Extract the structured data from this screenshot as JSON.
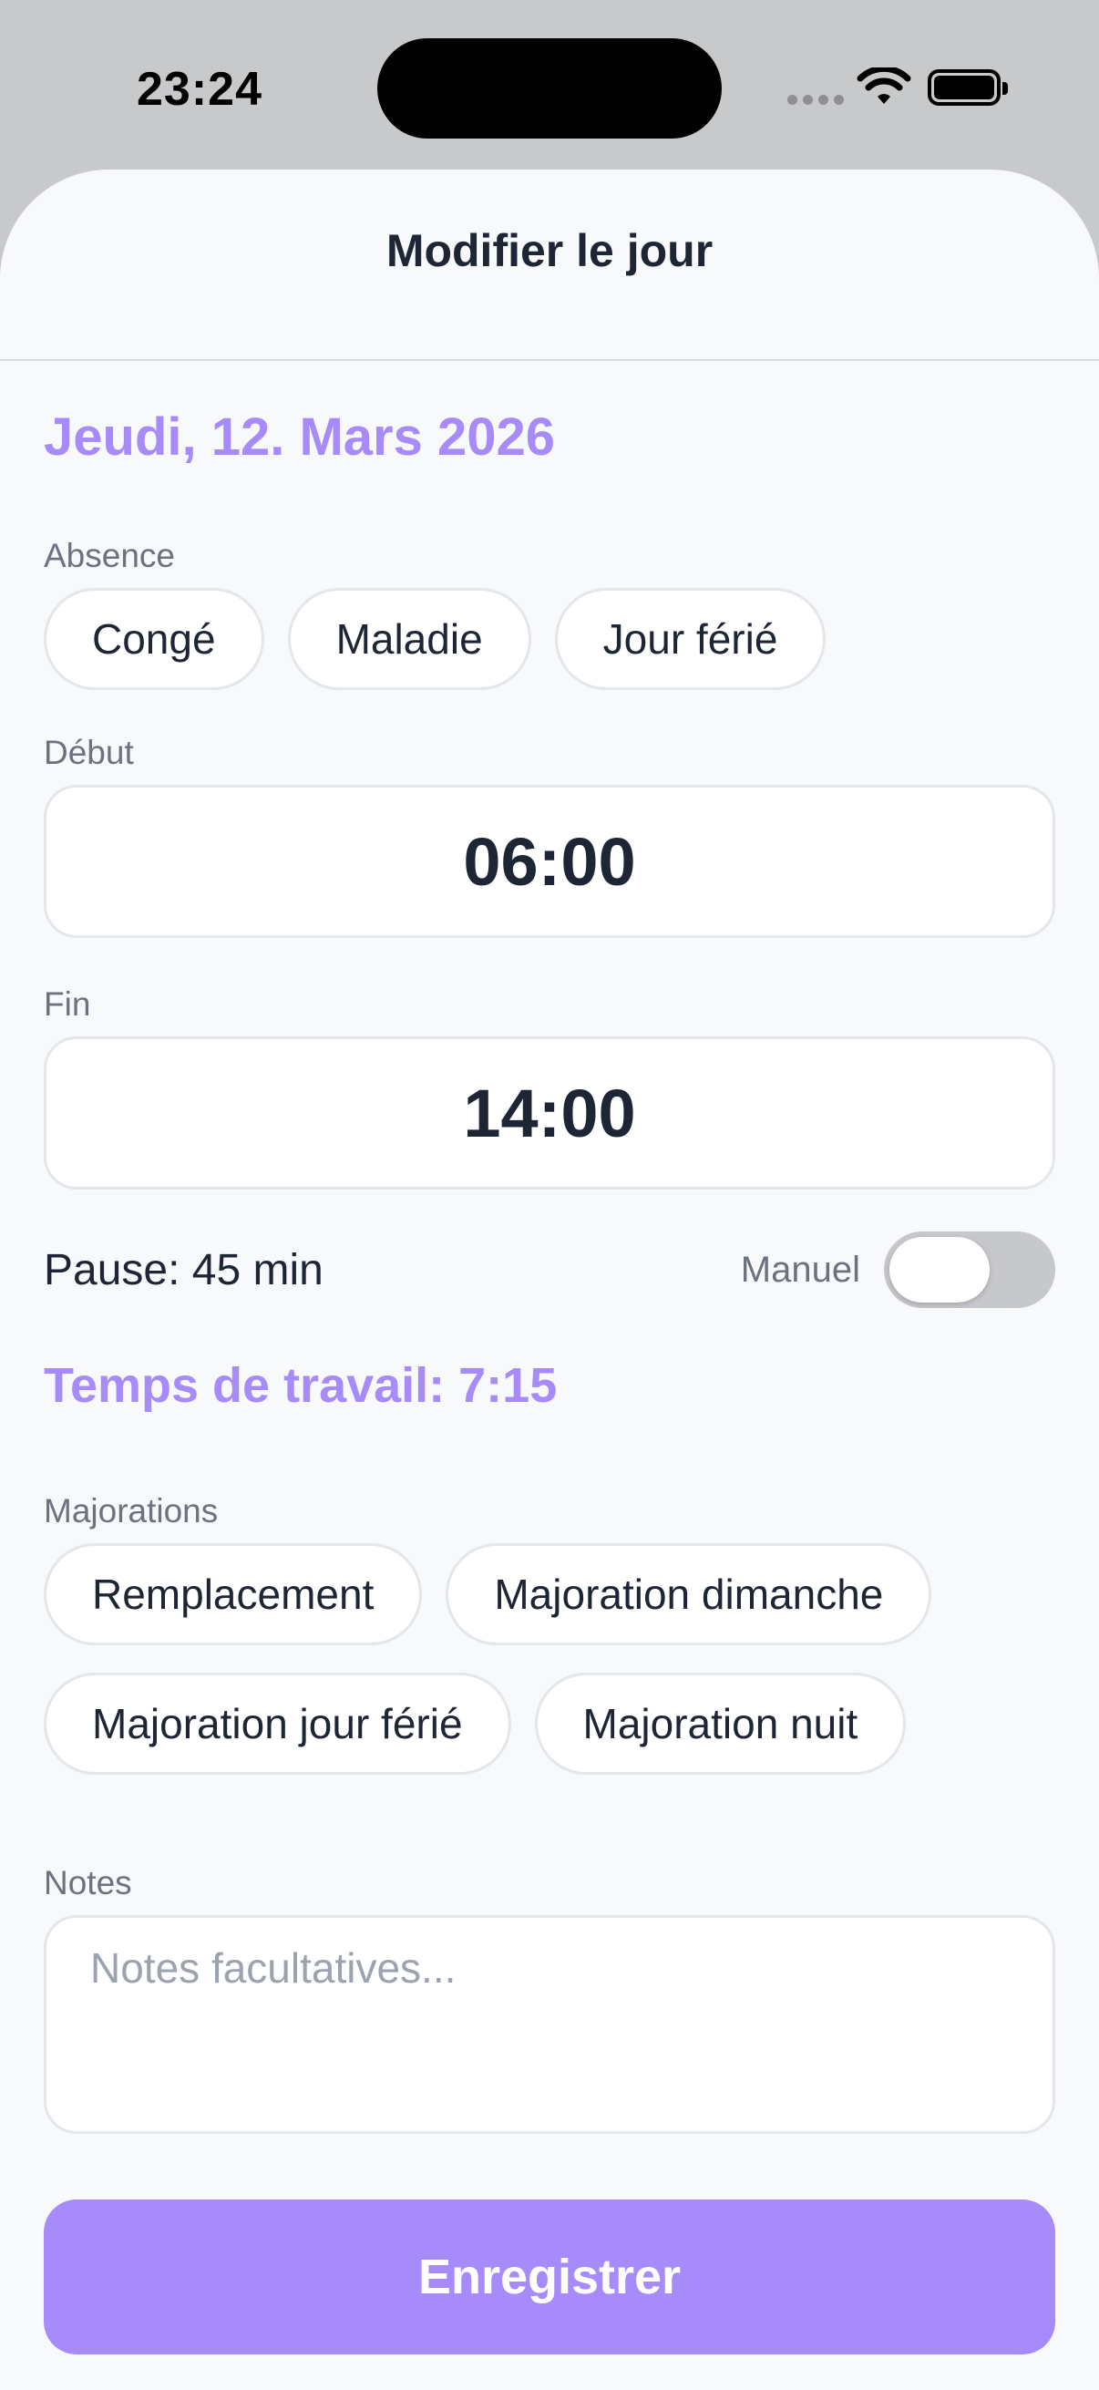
{
  "status_bar": {
    "time": "23:24"
  },
  "sheet": {
    "title": "Modifier le jour"
  },
  "date": "Jeudi, 12. Mars 2026",
  "absence": {
    "label": "Absence",
    "options": [
      "Congé",
      "Maladie",
      "Jour férié"
    ]
  },
  "start": {
    "label": "Début",
    "value": "06:00"
  },
  "end": {
    "label": "Fin",
    "value": "14:00"
  },
  "pause": {
    "text": "Pause: 45 min",
    "manual_label": "Manuel",
    "manual_on": false
  },
  "worktime": "Temps de travail: 7:15",
  "surcharges": {
    "label": "Majorations",
    "options": [
      "Remplacement",
      "Majoration dimanche",
      "Majoration jour férié",
      "Majoration nuit"
    ]
  },
  "notes": {
    "label": "Notes",
    "placeholder": "Notes facultatives..."
  },
  "save_label": "Enregistrer",
  "colors": {
    "accent": "#a78bfa",
    "text": "#1e2636",
    "muted": "#6b7280"
  }
}
